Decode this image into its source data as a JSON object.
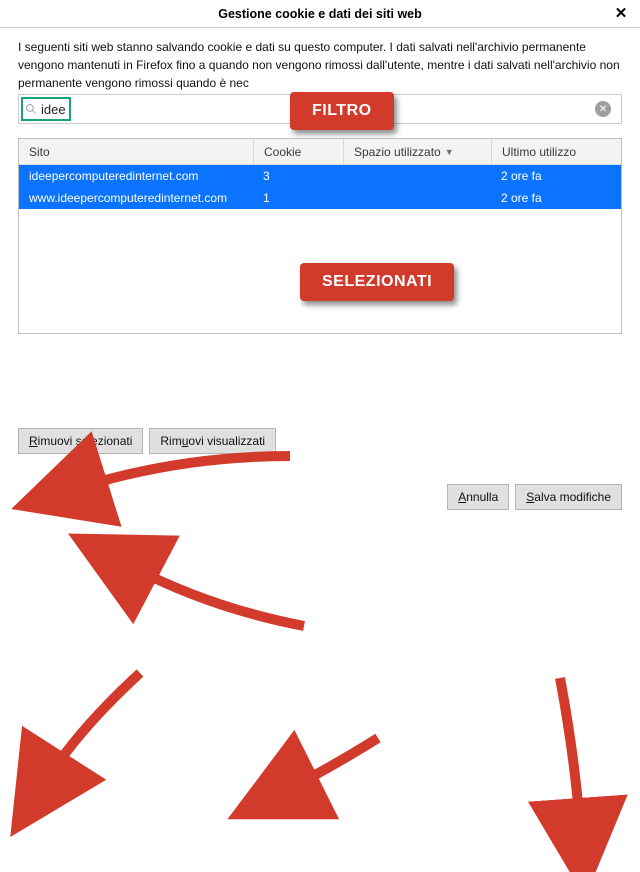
{
  "title": "Gestione cookie e dati dei siti web",
  "intro_text": "I seguenti siti web stanno salvando cookie e dati su questo computer. I dati salvati nell'archivio permanente vengono mantenuti in Firefox fino a quando non vengono rimossi dall'utente, mentre i dati salvati nell'archivio non permanente vengono rimossi quando è nec",
  "search": {
    "value": "idee"
  },
  "table": {
    "headers": {
      "site": "Sito",
      "cookie": "Cookie",
      "space": "Spazio utilizzato",
      "last": "Ultimo utilizzo"
    },
    "rows": [
      {
        "site": "ideepercomputeredinternet.com",
        "cookie": "3",
        "space": "",
        "last": "2 ore fa"
      },
      {
        "site": "www.ideepercomputeredinternet.com",
        "cookie": "1",
        "space": "",
        "last": "2 ore fa"
      }
    ]
  },
  "buttons": {
    "remove_selected": "Rimuovi selezionati",
    "remove_shown": "Rimuovi visualizzati",
    "cancel": "Annulla",
    "save": "Salva modifiche"
  },
  "callouts": {
    "filter": "FILTRO",
    "selected": "SELEZIONATI"
  }
}
